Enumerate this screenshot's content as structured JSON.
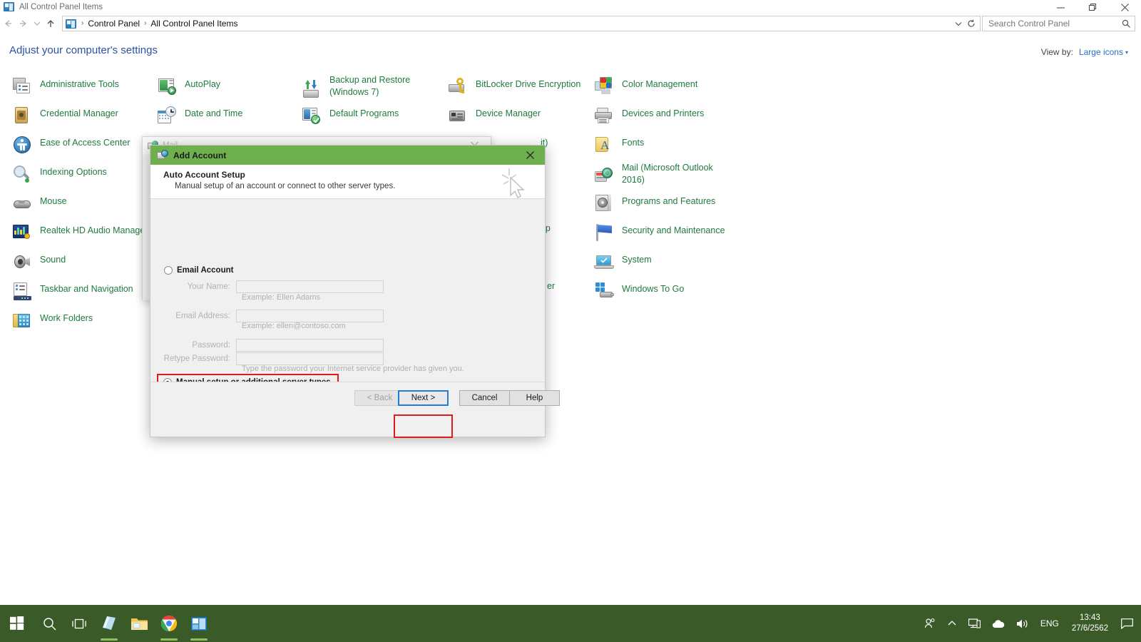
{
  "window": {
    "title": "All Control Panel Items",
    "title_icon": "control-panel-icon",
    "minimize_label": "Minimize",
    "maximize_label": "Maximize",
    "close_label": "Close"
  },
  "address_bar": {
    "back_label": "Back",
    "forward_label": "Forward",
    "recent_label": "Recent locations",
    "up_label": "Up",
    "crumbs": [
      "Control Panel",
      "All Control Panel Items"
    ],
    "separator": "›",
    "chevron": "⌄",
    "refresh": "↻"
  },
  "search": {
    "placeholder": "Search Control Panel",
    "value": "",
    "icon": "search-icon"
  },
  "content": {
    "heading": "Adjust your computer's settings",
    "view_by_label": "View by:",
    "view_by_value": "Large icons",
    "view_by_caret": "▾"
  },
  "control_panel_items": {
    "col1": [
      {
        "label": "Administrative Tools",
        "icon": "administrative-tools-icon"
      },
      {
        "label": "Credential Manager",
        "icon": "credential-manager-icon"
      },
      {
        "label": "Ease of Access Center",
        "icon": "ease-of-access-center-icon"
      },
      {
        "label": "Indexing Options",
        "icon": "indexing-options-icon"
      },
      {
        "label": "Mouse",
        "icon": "mouse-icon"
      },
      {
        "label": "Realtek HD Audio Manager",
        "icon": "realtek-hd-audio-manager-icon"
      },
      {
        "label": "Sound",
        "icon": "sound-icon"
      },
      {
        "label": "Taskbar and Navigation",
        "icon": "taskbar-and-navigation-icon"
      },
      {
        "label": "Work Folders",
        "icon": "work-folders-icon"
      }
    ],
    "col2": [
      {
        "label": "AutoPlay",
        "icon": "autoplay-icon"
      },
      {
        "label": "Date and Time",
        "icon": "date-and-time-icon"
      }
    ],
    "col3": [
      {
        "label": "Backup and Restore (Windows 7)",
        "icon": "backup-and-restore-icon",
        "two_line": true
      },
      {
        "label": "Default Programs",
        "icon": "default-programs-icon"
      }
    ],
    "col4": [
      {
        "label": "BitLocker Drive Encryption",
        "icon": "bitlocker-drive-encryption-icon"
      },
      {
        "label": "Device Manager",
        "icon": "device-manager-icon"
      }
    ],
    "col4_obscured": [
      {
        "label": "it)",
        "icon": "obscured-icon"
      },
      {
        "label": "esktop",
        "icon": "obscured-icon"
      },
      {
        "label": "er",
        "icon": "obscured-icon"
      }
    ],
    "col5": [
      {
        "label": "Color Management",
        "icon": "color-management-icon"
      },
      {
        "label": "Devices and Printers",
        "icon": "devices-and-printers-icon"
      },
      {
        "label": "Fonts",
        "icon": "fonts-icon"
      },
      {
        "label": "Mail (Microsoft Outlook 2016)",
        "icon": "mail-icon",
        "two_line": true
      },
      {
        "label": "Programs and Features",
        "icon": "programs-and-features-icon"
      },
      {
        "label": "Security and Maintenance",
        "icon": "security-and-maintenance-icon"
      },
      {
        "label": "System",
        "icon": "system-icon"
      },
      {
        "label": "Windows To Go",
        "icon": "windows-to-go-icon"
      }
    ]
  },
  "mail_dialog": {
    "title": "Mail",
    "icon": "mail-setup-icon",
    "chevron": "⌄"
  },
  "add_account_dialog": {
    "title": "Add Account",
    "title_icon": "add-account-icon",
    "close_glyph": "✕",
    "header_title": "Auto Account Setup",
    "header_subtitle": "Manual setup of an account or connect to other server types.",
    "email_account_label": "Email Account",
    "email_account_selected": false,
    "fields": [
      {
        "label": "Your Name:",
        "value": "",
        "hint": "Example: Ellen Adams"
      },
      {
        "label": "Email Address:",
        "value": "",
        "hint": "Example: ellen@contoso.com"
      },
      {
        "label": "Password:",
        "value": "",
        "hint": ""
      },
      {
        "label": "Retype Password:",
        "value": "",
        "hint": "Type the password your Internet service provider has given you."
      }
    ],
    "manual_setup_label": "Manual setup or additional server types",
    "manual_setup_selected": true,
    "buttons": {
      "back": "< Back",
      "next": "Next >",
      "cancel": "Cancel",
      "help": "Help"
    },
    "highlight_color": "#e01b1b",
    "focus_color": "#1f7fd4",
    "titlebar_color": "#6db04d"
  },
  "taskbar": {
    "start_label": "Start",
    "items": [
      {
        "name": "search-icon",
        "label": "Search"
      },
      {
        "name": "task-view-icon",
        "label": "Task View"
      },
      {
        "name": "sticky-notes-icon",
        "label": "Sticky Notes",
        "running": true
      },
      {
        "name": "file-explorer-icon",
        "label": "File Explorer",
        "running": false
      },
      {
        "name": "google-chrome-icon",
        "label": "Google Chrome",
        "running": true
      },
      {
        "name": "control-panel-icon",
        "label": "Control Panel",
        "running": true
      }
    ],
    "tray": {
      "people_icon": "people-icon",
      "show_hidden_icon": "chevron-up-icon",
      "network_icon": "network-icon",
      "onedrive_icon": "onedrive-icon",
      "volume_icon": "volume-icon",
      "language": "ENG",
      "time": "13:43",
      "date": "27/6/2562",
      "notification_icon": "action-center-icon"
    }
  },
  "colors": {
    "link_green": "#1f7a3f",
    "heading_blue": "#2a52a0",
    "accent_blue": "#2a6ec4",
    "taskbar": "#3a5a28",
    "dialog_green": "#6db04d"
  }
}
